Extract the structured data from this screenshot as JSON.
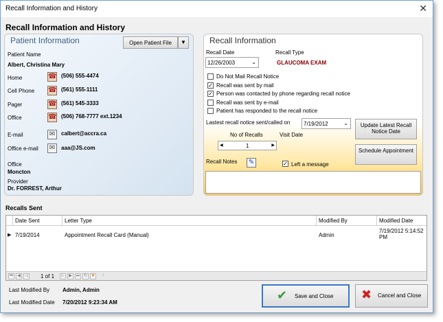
{
  "window": {
    "title": "Recall Information and History",
    "close_glyph": "✕"
  },
  "heading": "Recall Information and History",
  "patient": {
    "section_title": "Patient Information",
    "open_file_label": "Open Patient File",
    "name_label": "Patient Name",
    "name": "Albert, Christina Mary",
    "home_label": "Home",
    "home": "(506) 555-4474",
    "cell_label": "Cell Phone",
    "cell": "(561) 555-1111",
    "pager_label": "Pager",
    "pager": "(561) 545-3333",
    "office_phone_label": "Office",
    "office_phone": "(506) 768-7777 ext.1234",
    "email_label": "E-mail",
    "email": "calbert@accra.ca",
    "office_email_label": "Office e-mail",
    "office_email": "aaa@JS.com",
    "office_label": "Office",
    "office": "Moncton",
    "provider_label": "Provider",
    "provider": "Dr. FORREST, Arthur"
  },
  "recall": {
    "section_title": "Recall Information",
    "date_label": "Recall Date",
    "date": "12/26/2003",
    "type_label": "Recall Type",
    "type": "GLAUCOMA EXAM",
    "checks": [
      {
        "label": "Do Not Mail Recall Notice",
        "checked": false
      },
      {
        "label": "Recall was sent by mail",
        "checked": true
      },
      {
        "label": "Person was contacted by phone regarding recall notice",
        "checked": true
      },
      {
        "label": "Recall was sent by e-mail",
        "checked": false
      },
      {
        "label": "Patient has responded to the recall notice",
        "checked": false
      }
    ],
    "latest_label": "Lastest recall notice sent/called on",
    "latest_date": "7/19/2012",
    "update_btn": "Update Latest Recall Notice Date",
    "num_recalls_label": "No of Recalls",
    "num_recalls": "1",
    "visit_date_label": "Visit Date",
    "schedule_btn": "Schedule Appointment",
    "notes_label": "Recall Notes",
    "left_message_label": "Left a message",
    "left_message_checked": true
  },
  "recalls_sent": {
    "title": "Recalls Sent",
    "columns": [
      "Date Sent",
      "Letter Type",
      "Modified By",
      "Modified Date"
    ],
    "rows": [
      [
        "7/19/2014",
        "Appointment Recall Card (Manual)",
        "Admin",
        "7/19/2012 5:14:52 PM"
      ]
    ],
    "page_text": "1 of 1"
  },
  "footer": {
    "modified_by_label": "Last Modified By",
    "modified_by": "Admin, Admin",
    "modified_date_label": "Last Modified Date",
    "modified_date": "7/20/2012 9:23:34 AM",
    "save_label": "Save and Close",
    "cancel_label": "Cancel and Close"
  },
  "colors": {
    "save_check": "#3a9a3a",
    "cancel_x": "#cc2222",
    "patient_title": "#3b5f86",
    "recall_type": "#8a0000"
  }
}
